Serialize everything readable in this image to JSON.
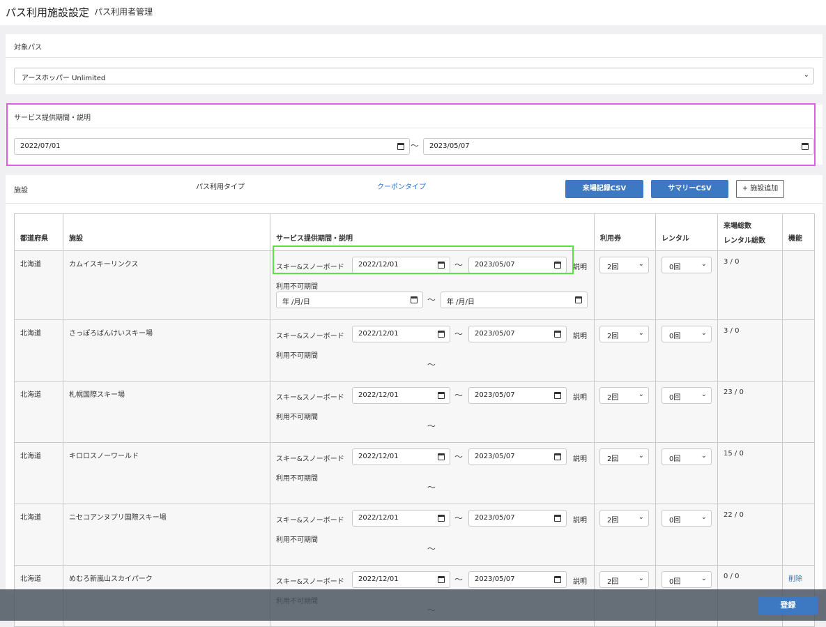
{
  "header": {
    "title": "パス利用施設設定",
    "subtitle": "パス利用者管理"
  },
  "target_pass": {
    "label": "対象パス",
    "selected": "アースホッパー Unlimited"
  },
  "service_period": {
    "label": "サービス提供期間・説明",
    "start": "2022/07/01",
    "end": "2023/05/07",
    "tilde": "〜"
  },
  "facility_bar": {
    "label": "施設",
    "pass_type_label": "パス利用タイプ",
    "coupon_type_link": "クーポンタイプ",
    "visit_csv": "来場記録CSV",
    "summary_csv": "サマリーCSV",
    "add_facility": "+ 施設追加"
  },
  "table": {
    "headers": {
      "prefecture": "都道府県",
      "facility": "施設",
      "period": "サービス提供期間・説明",
      "ticket": "利用券",
      "rental": "レンタル",
      "totals_line1": "来場総数",
      "totals_line2": "レンタル総数",
      "function": "機能"
    },
    "plan_label": "スキー&スノーボード",
    "desc_label": "説明",
    "unavailable_label": "利用不可期間",
    "date_placeholder": "年 /月/日",
    "rows": [
      {
        "prefecture": "北海道",
        "facility": "カムイスキーリンクス",
        "start": "2022/12/01",
        "end": "2023/05/07",
        "ticket": "2回",
        "rental": "0回",
        "totals": "3 / 0",
        "action": ""
      },
      {
        "prefecture": "北海道",
        "facility": "さっぽろばんけいスキー場",
        "start": "2022/12/01",
        "end": "2023/05/07",
        "ticket": "2回",
        "rental": "0回",
        "totals": "3 / 0",
        "action": ""
      },
      {
        "prefecture": "北海道",
        "facility": "札幌国際スキー場",
        "start": "2022/12/01",
        "end": "2023/05/07",
        "ticket": "2回",
        "rental": "0回",
        "totals": "23 / 0",
        "action": ""
      },
      {
        "prefecture": "北海道",
        "facility": "キロロスノーワールド",
        "start": "2022/12/01",
        "end": "2023/05/07",
        "ticket": "2回",
        "rental": "0回",
        "totals": "15 / 0",
        "action": ""
      },
      {
        "prefecture": "北海道",
        "facility": "ニセコアンヌプリ国際スキー場",
        "start": "2022/12/01",
        "end": "2023/05/07",
        "ticket": "2回",
        "rental": "0回",
        "totals": "22 / 0",
        "action": ""
      },
      {
        "prefecture": "北海道",
        "facility": "めむろ新嵐山スカイパーク",
        "start": "2022/12/01",
        "end": "2023/05/07",
        "ticket": "2回",
        "rental": "0回",
        "totals": "0 / 0",
        "action": "削除"
      }
    ]
  },
  "footer": {
    "register": "登録"
  },
  "colors": {
    "accent": "#3c79c2",
    "highlight_pink": "#e05ce6",
    "highlight_green": "#57e43e"
  }
}
